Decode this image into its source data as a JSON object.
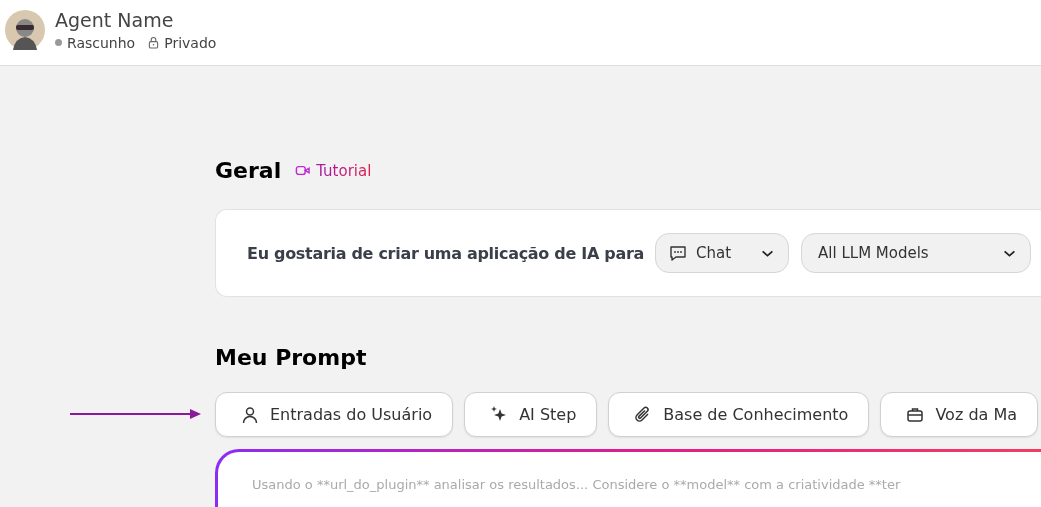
{
  "header": {
    "agent_name": "Agent Name",
    "status": "Rascunho",
    "visibility": "Privado"
  },
  "general": {
    "title": "Geral",
    "tutorial_link": "Tutorial",
    "sentence": "Eu gostaria de criar uma aplicação de IA para",
    "app_type": "Chat",
    "model": "All LLM Models"
  },
  "prompt": {
    "title": "Meu Prompt",
    "tools": [
      {
        "kind": "user",
        "label": "Entradas do Usuário"
      },
      {
        "kind": "ai",
        "label": "AI Step"
      },
      {
        "kind": "attach",
        "label": "Base de Conhecimento"
      },
      {
        "kind": "voice",
        "label": "Voz da Ma"
      }
    ],
    "text": "Usando o **url_do_plugin** analisar os resultados... Considere o **model** com a criatividade **ter"
  }
}
